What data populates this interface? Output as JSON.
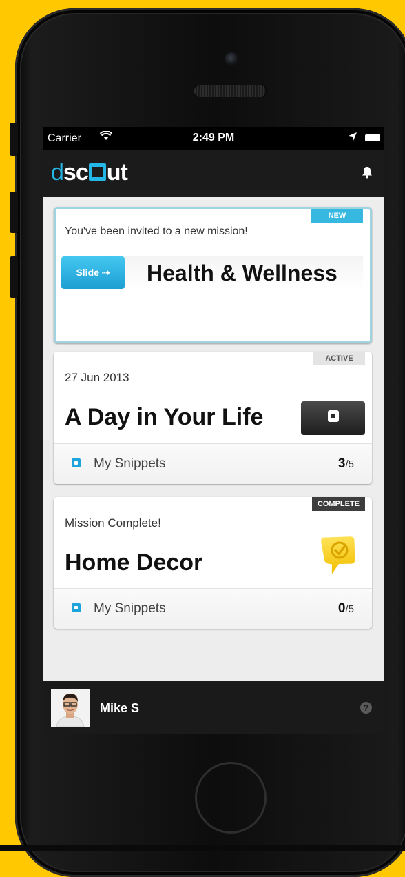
{
  "status_bar": {
    "carrier": "Carrier",
    "time": "2:49 PM"
  },
  "app": {
    "logo_d": "d",
    "logo_sc": "sc",
    "logo_ut": "ut"
  },
  "invite_card": {
    "tag": "NEW",
    "message": "You've been invited to a new mission!",
    "slide_label": "Slide ⇢",
    "title": "Health & Wellness"
  },
  "active_card": {
    "tag": "ACTIVE",
    "date": "27 Jun 2013",
    "title": "A Day in Your Life",
    "snippets_label": "My Snippets",
    "snippets_done": "3",
    "snippets_total": "/5"
  },
  "complete_card": {
    "tag": "COMPLETE",
    "status": "Mission Complete!",
    "title": "Home Decor",
    "snippets_label": "My Snippets",
    "snippets_done": "0",
    "snippets_total": "/5"
  },
  "footer": {
    "user_name": "Mike S",
    "help": "?"
  },
  "colors": {
    "background": "#FFC800",
    "accent": "#24B6E6",
    "navbar": "#1B1B1B"
  },
  "icons": [
    "wifi-icon",
    "location-arrow-icon",
    "battery-icon",
    "bell-icon",
    "chat-snippet-icon",
    "mission-complete-badge-icon",
    "help-icon"
  ]
}
